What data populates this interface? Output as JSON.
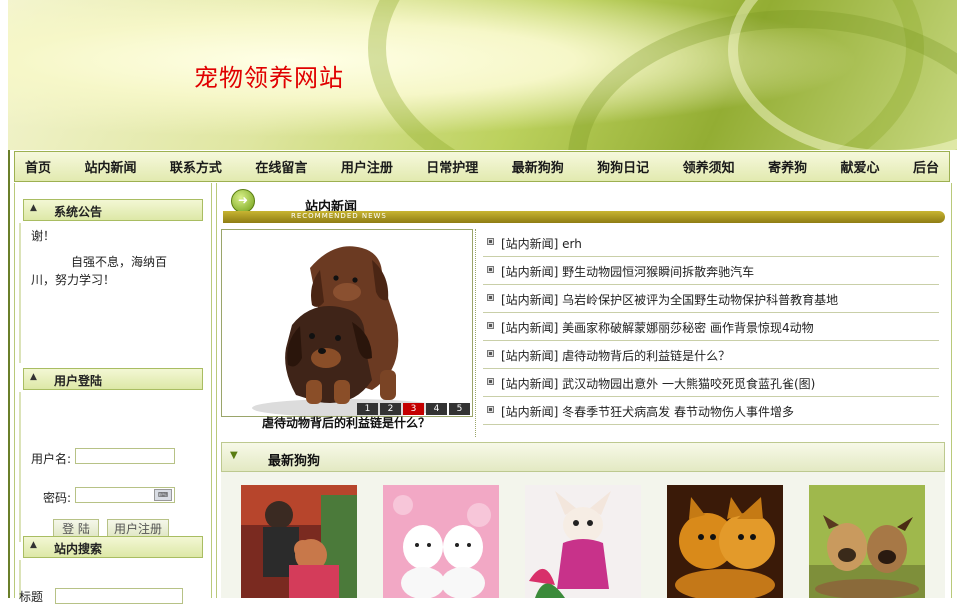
{
  "site": {
    "title": "宠物领养网站"
  },
  "nav": [
    "首页",
    "站内新闻",
    "联系方式",
    "在线留言",
    "用户注册",
    "日常护理",
    "最新狗狗",
    "狗狗日记",
    "领养须知",
    "寄养狗",
    "献爱心",
    "后台"
  ],
  "sidebar": {
    "notice": {
      "title": "系统公告",
      "text_top": "谢！",
      "text_body": "自强不息，海纳百川，努力学习！"
    },
    "login": {
      "title": "用户登陆",
      "username_label": "用户名:",
      "password_label": "密码:",
      "login_button": "登 陆",
      "register_button": "用户注册"
    },
    "search": {
      "title": "站内搜索",
      "field_label": "标题"
    }
  },
  "news": {
    "heading": "站内新闻",
    "strip_subtitle": "RECOMMENDED NEWS",
    "featured_caption": "虐待动物背后的利益链是什么？",
    "pager": [
      "1",
      "2",
      "3",
      "4",
      "5"
    ],
    "pager_active": 2,
    "items": [
      "[站内新闻] erh",
      "[站内新闻] 野生动物园恒河猴瞬间拆散奔驰汽车",
      "[站内新闻] 乌岩岭保护区被评为全国野生动物保护科普教育基地",
      "[站内新闻] 美画家称破解蒙娜丽莎秘密 画作背景惊现4动物",
      "[站内新闻] 虐待动物背后的利益链是什么？",
      "[站内新闻] 武汉动物园出意外 一大熊猫咬死觅食蓝孔雀(图)",
      "[站内新闻] 冬春季节狂犬病高发 春节动物伤人事件增多"
    ]
  },
  "latest_dogs": {
    "title": "最新狗狗",
    "thumbs": [
      "dog-thumb-poodle",
      "dog-thumb-white-puppies",
      "dog-thumb-chihuahua",
      "dog-thumb-pomeranians",
      "dog-thumb-pug-puppies"
    ]
  },
  "colors": {
    "title_red": "#e00000",
    "accent_green": "#9db051",
    "strip_gold": "#c8b532"
  }
}
